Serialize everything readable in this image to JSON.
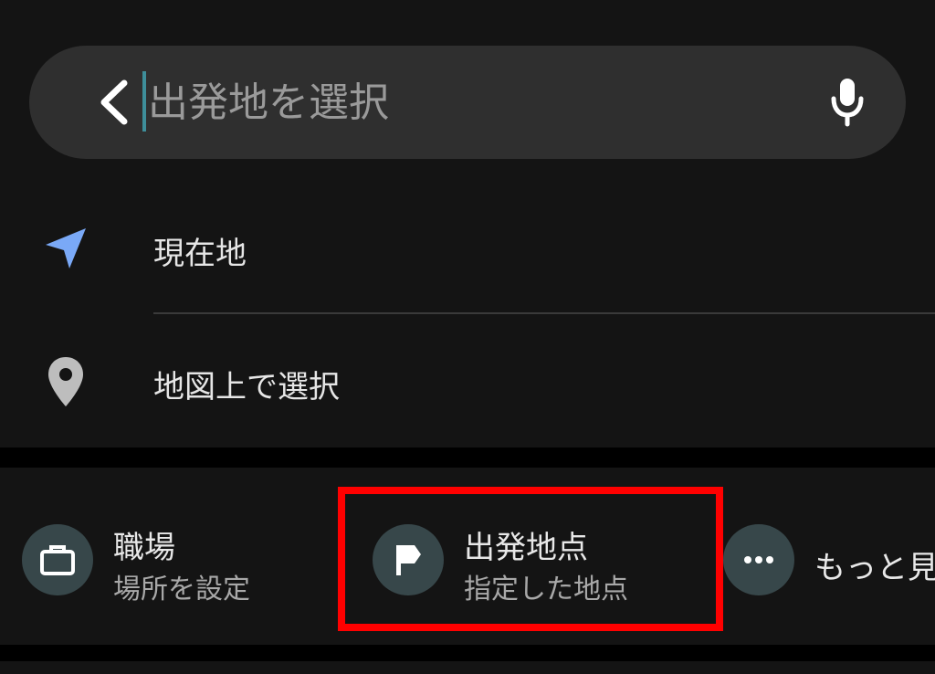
{
  "search": {
    "placeholder": "出発地を選択",
    "value": "",
    "back_icon": "chevron-left-icon",
    "mic_icon": "microphone-icon"
  },
  "options": [
    {
      "label": "現在地",
      "icon": "navigation-arrow-icon",
      "icon_color": "#7aa9f7"
    },
    {
      "label": "地図上で選択",
      "icon": "map-pin-icon",
      "icon_color": "#bdbdbd"
    }
  ],
  "shortcuts": [
    {
      "title": "職場",
      "subtitle": "場所を設定",
      "icon": "briefcase-icon"
    },
    {
      "title": "出発地点",
      "subtitle": "指定した地点",
      "icon": "flag-icon"
    },
    {
      "title": "もっと見",
      "icon": "more-horizontal-icon"
    }
  ],
  "colors": {
    "background": "#141414",
    "search_bar": "#2f2f2f",
    "chip_circle": "#37474a",
    "highlight": "#ff0000",
    "cursor": "#3e8e9a"
  }
}
